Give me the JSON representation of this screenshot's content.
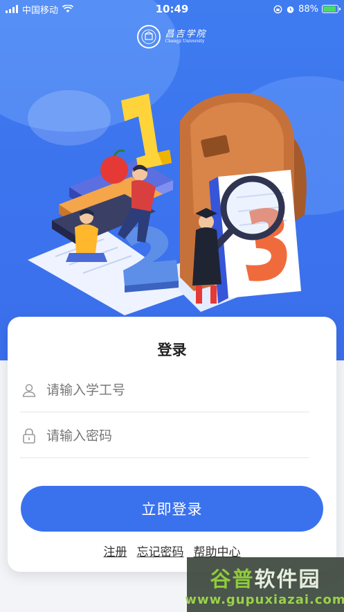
{
  "status_bar": {
    "carrier": "中国移动",
    "time": "10:49",
    "battery_percent": "88%",
    "battery_level": 0.88
  },
  "logo": {
    "name_cn": "昌吉学院",
    "name_en": "Changji University"
  },
  "login": {
    "title": "登录",
    "username_placeholder": "请输入学工号",
    "password_placeholder": "请输入密码",
    "submit_label": "立即登录",
    "links": [
      "注册",
      "忘记密码",
      "帮助中心"
    ]
  },
  "watermark": {
    "title_part1": "谷普",
    "title_part2": "软件园",
    "url": "www.gupuxiazai.com"
  },
  "colors": {
    "primary": "#3a72ee",
    "hero": "#3f7cf0"
  },
  "icons": {
    "user": "user-icon",
    "lock": "lock-icon",
    "wifi": "wifi-icon",
    "signal": "signal-icon",
    "battery": "battery-icon",
    "alarm": "alarm-icon"
  }
}
